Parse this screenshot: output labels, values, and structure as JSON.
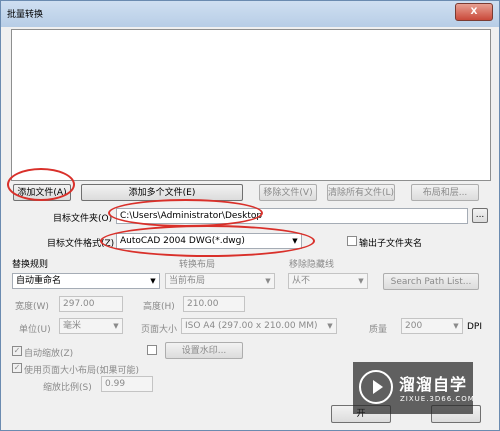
{
  "window": {
    "title": "批量转换",
    "close_label": "X"
  },
  "buttons": {
    "add_file": "添加文件(A)",
    "add_multiple": "添加多个文件(E)",
    "remove_file": "移除文件(V)",
    "clear_all": "清除所有文件(L)",
    "layout": "布局和层...",
    "browse": "..."
  },
  "target_folder": {
    "label": "目标文件夹(O)",
    "value": "C:\\Users\\Administrator\\Desktop"
  },
  "target_format": {
    "label": "目标文件格式(Z)",
    "value": "AutoCAD 2004 DWG(*.dwg)"
  },
  "output_subfolder": {
    "label": "输出子文件夹名",
    "checked": false
  },
  "replace_rule": {
    "label": "替换规则",
    "value": "自动重命名"
  },
  "convert_layout": {
    "label": "转换布局",
    "value": "当前布局"
  },
  "hidden_lines": {
    "label": "移除隐藏线",
    "value": "从不"
  },
  "search_path": "Search Path List...",
  "width": {
    "label": "宽度(W)",
    "value": "297.00"
  },
  "height": {
    "label": "高度(H)",
    "value": "210.00"
  },
  "unit": {
    "label": "单位(U)",
    "value": "毫米"
  },
  "page_size": {
    "label": "页面大小",
    "value": "ISO A4 (297.00 x 210.00 MM)"
  },
  "quality": {
    "label": "质量",
    "value": "200",
    "unit": "DPI"
  },
  "auto_zoom": {
    "label": "自动缩放(Z)",
    "checked": true
  },
  "watermark": {
    "label": "设置水印...",
    "checked": false
  },
  "use_page_size": {
    "label": "使用页面大小布局(如果可能)",
    "checked": true
  },
  "zoom_ratio": {
    "label": "缩放比例(S)",
    "value": "0.99"
  },
  "bottom_button": "开",
  "overlay": {
    "brand": "溜溜自学",
    "domain": "ZIXUE.3D66.COM"
  },
  "colors": {
    "annotation": "#d9302a",
    "titlebar": "#b7cde6"
  }
}
